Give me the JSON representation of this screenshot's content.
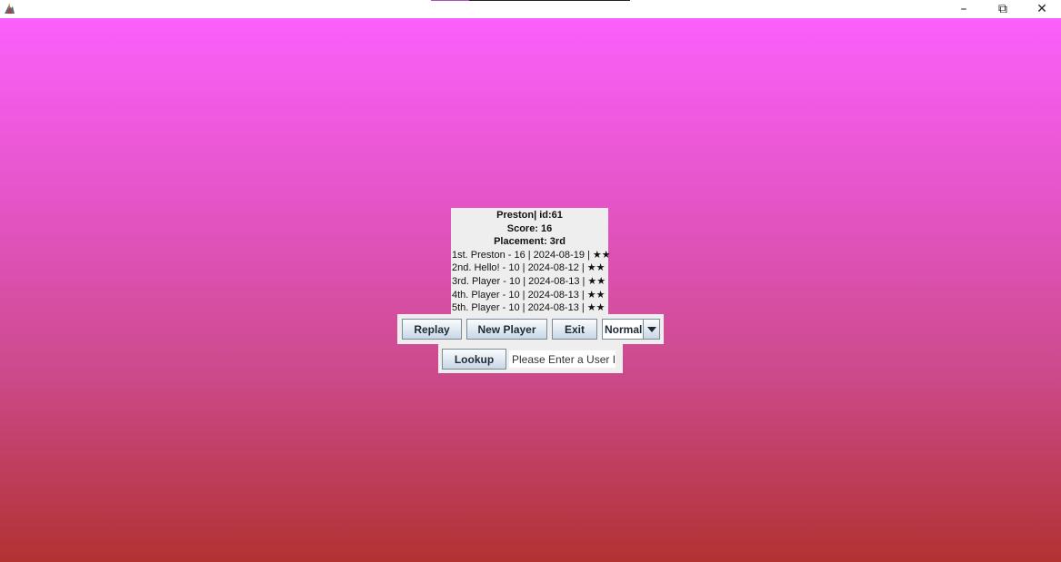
{
  "window": {
    "controls": {
      "minimize": "–",
      "restore": "⧉",
      "close": "✕"
    },
    "icons": {
      "app": "java-app-icon",
      "minimize": "minimize-icon",
      "restore": "restore-icon",
      "close": "close-icon"
    }
  },
  "background": {
    "gradient_top": "#fb60fb",
    "gradient_bottom": "#b23232"
  },
  "result": {
    "player_line": "Preston| id:61",
    "score_line": "Score: 16",
    "placement_line": "Placement: 3rd"
  },
  "leaderboard": [
    "1st. Preston - 16 | 2024-08-19 | ★★",
    "2nd. Hello! - 10 | 2024-08-12 | ★★",
    "3rd. Player - 10 | 2024-08-13 | ★★",
    "4th. Player - 10 | 2024-08-13 | ★★",
    "5th. Player - 10 | 2024-08-13 | ★★"
  ],
  "controls": {
    "replay_label": "Replay",
    "new_player_label": "New Player",
    "exit_label": "Exit",
    "difficulty_selected": "Normal",
    "difficulty_arrow_icon": "dropdown-arrow-icon"
  },
  "lookup": {
    "button_label": "Lookup",
    "input_value": "Please Enter a User ID"
  }
}
